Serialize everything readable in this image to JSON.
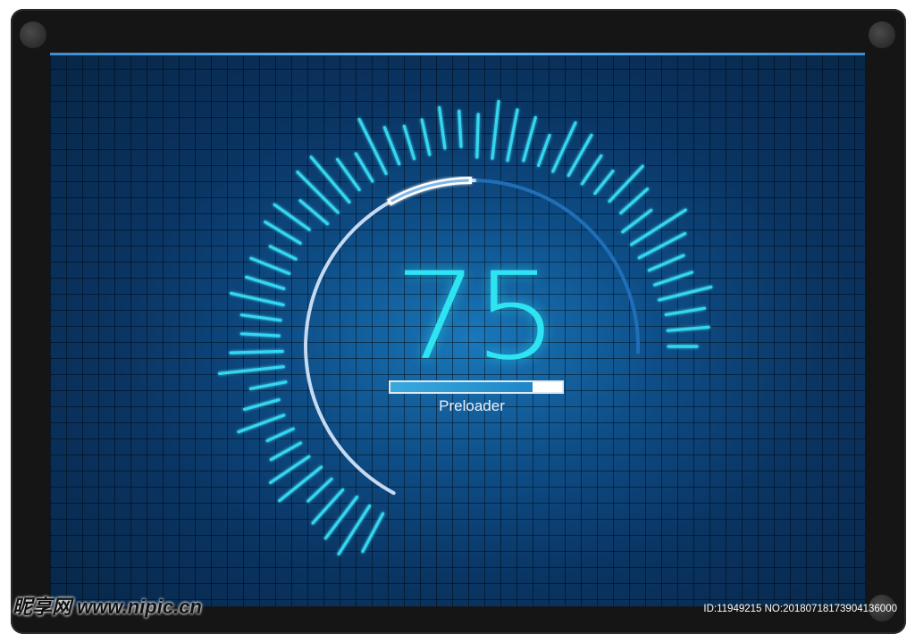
{
  "gauge": {
    "value": "75",
    "progress_fraction": 0.83,
    "label": "Preloader"
  },
  "watermark": {
    "left_text": "昵享网 www.nipic.cn",
    "right_text": "ID:11949215 NO:20180718173904136000"
  },
  "colors": {
    "accent": "#2ee4f2",
    "screen_bg": "#0a3462",
    "arc_light": "#c6daf2",
    "arc_dark": "#1e6fb7",
    "frame": "#151515"
  },
  "icons": [
    "screw-icon"
  ]
}
